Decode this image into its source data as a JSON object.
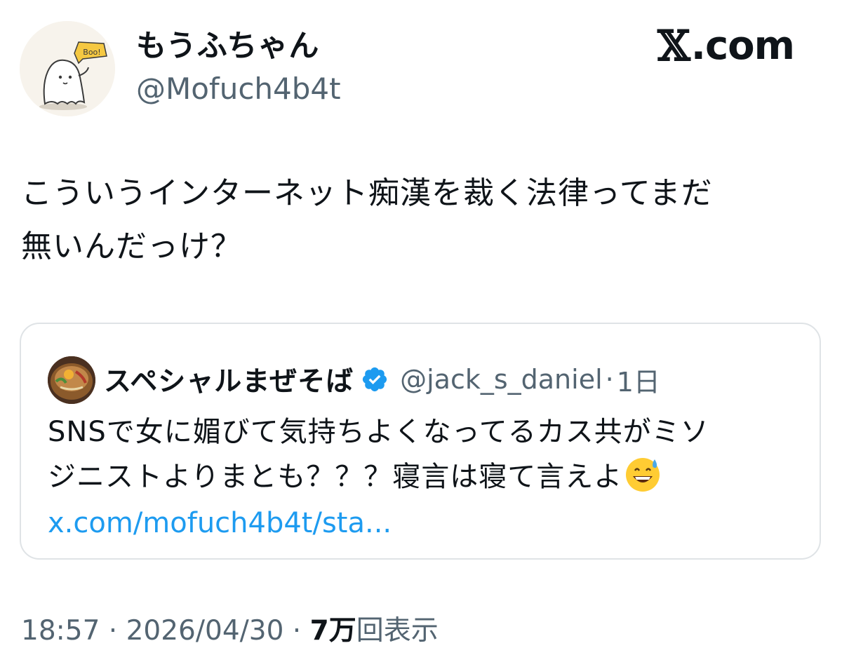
{
  "author": {
    "display_name": "もうふちゃん",
    "handle": "@Mofuch4b4t",
    "avatar_badge_text": "Boo!"
  },
  "brand": {
    "x_glyph": "𝕏",
    "label": ".com"
  },
  "tweet": {
    "text": "こういうインターネット痴漢を裁く法律ってまだ\n無いんだっけ？"
  },
  "quote": {
    "display_name": "スペシャルまぜそば",
    "verified_icon": "verified-badge-icon",
    "handle": "@jack_s_daniel",
    "separator": "·",
    "time": "1日",
    "text": "SNSで女に媚びて気持ちよくなってるカス共がミソ\nジニストよりまとも？？？寝言は寝て言えよ",
    "emoji": "grinning-sweat-emoji",
    "link": "x.com/mofuch4b4t/sta..."
  },
  "meta": {
    "time": "18:57",
    "dot1": " · ",
    "date": "2026/04/30",
    "dot2": " · ",
    "views_count": "7万",
    "views_label": "回表示"
  },
  "colors": {
    "text": "#0f1419",
    "secondary": "#536471",
    "link": "#1d9bf0",
    "border": "#dfe3e6"
  }
}
